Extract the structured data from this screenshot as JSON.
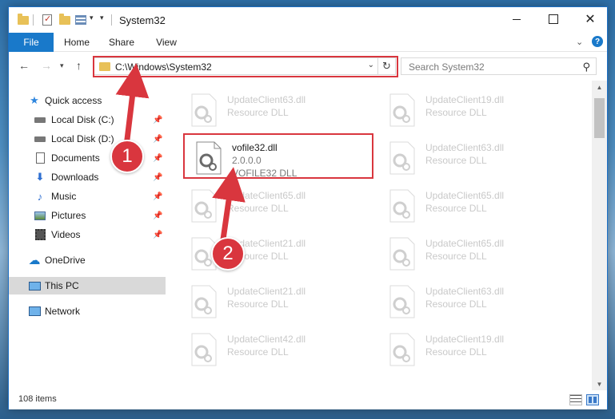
{
  "window": {
    "title": "System32"
  },
  "ribbon": {
    "tabs": [
      {
        "label": "File"
      },
      {
        "label": "Home"
      },
      {
        "label": "Share"
      },
      {
        "label": "View"
      }
    ],
    "help_symbol": "?"
  },
  "address": {
    "path": "C:\\Windows\\System32"
  },
  "search": {
    "placeholder": "Search System32"
  },
  "sidebar": {
    "items": [
      {
        "label": "Quick access",
        "icon": "star-icon",
        "pinned": false
      },
      {
        "label": "Local Disk (C:)",
        "icon": "drive-icon",
        "pinned": true
      },
      {
        "label": "Local Disk (D:)",
        "icon": "drive-icon",
        "pinned": true
      },
      {
        "label": "Documents",
        "icon": "documents-icon",
        "pinned": true
      },
      {
        "label": "Downloads",
        "icon": "download-icon",
        "pinned": true
      },
      {
        "label": "Music",
        "icon": "music-icon",
        "pinned": true
      },
      {
        "label": "Pictures",
        "icon": "pictures-icon",
        "pinned": true
      },
      {
        "label": "Videos",
        "icon": "videos-icon",
        "pinned": true
      },
      {
        "label": "OneDrive",
        "icon": "cloud-icon",
        "pinned": false
      },
      {
        "label": "This PC",
        "icon": "computer-icon",
        "pinned": false,
        "selected": true
      },
      {
        "label": "Network",
        "icon": "network-icon",
        "pinned": false
      }
    ]
  },
  "files": {
    "selected": {
      "name": "vofile32.dll",
      "version": "2.0.0.0",
      "description": "VOFILE32 DLL"
    },
    "left_column": [
      {
        "name": "UpdateClient63.dll",
        "type": "Resource DLL"
      },
      {
        "name": "UpdateClient65.dll",
        "type": "Resource DLL"
      },
      {
        "name": "UpdateClient21.dll",
        "type": "Resource DLL"
      },
      {
        "name": "UpdateClient21.dll",
        "type": "Resource DLL"
      },
      {
        "name": "UpdateClient42.dll",
        "type": "Resource DLL"
      }
    ],
    "right_column": [
      {
        "name": "UpdateClient19.dll",
        "type": "Resource DLL"
      },
      {
        "name": "UpdateClient63.dll",
        "type": "Resource DLL"
      },
      {
        "name": "UpdateClient65.dll",
        "type": "Resource DLL"
      },
      {
        "name": "UpdateClient65.dll",
        "type": "Resource DLL"
      },
      {
        "name": "UpdateClient63.dll",
        "type": "Resource DLL"
      },
      {
        "name": "UpdateClient19.dll",
        "type": "Resource DLL"
      }
    ]
  },
  "status": {
    "item_count": "108 items"
  },
  "annotations": {
    "step_1": "1",
    "step_2": "2"
  },
  "colors": {
    "accent": "#1979ca",
    "highlight": "#d9363e"
  }
}
